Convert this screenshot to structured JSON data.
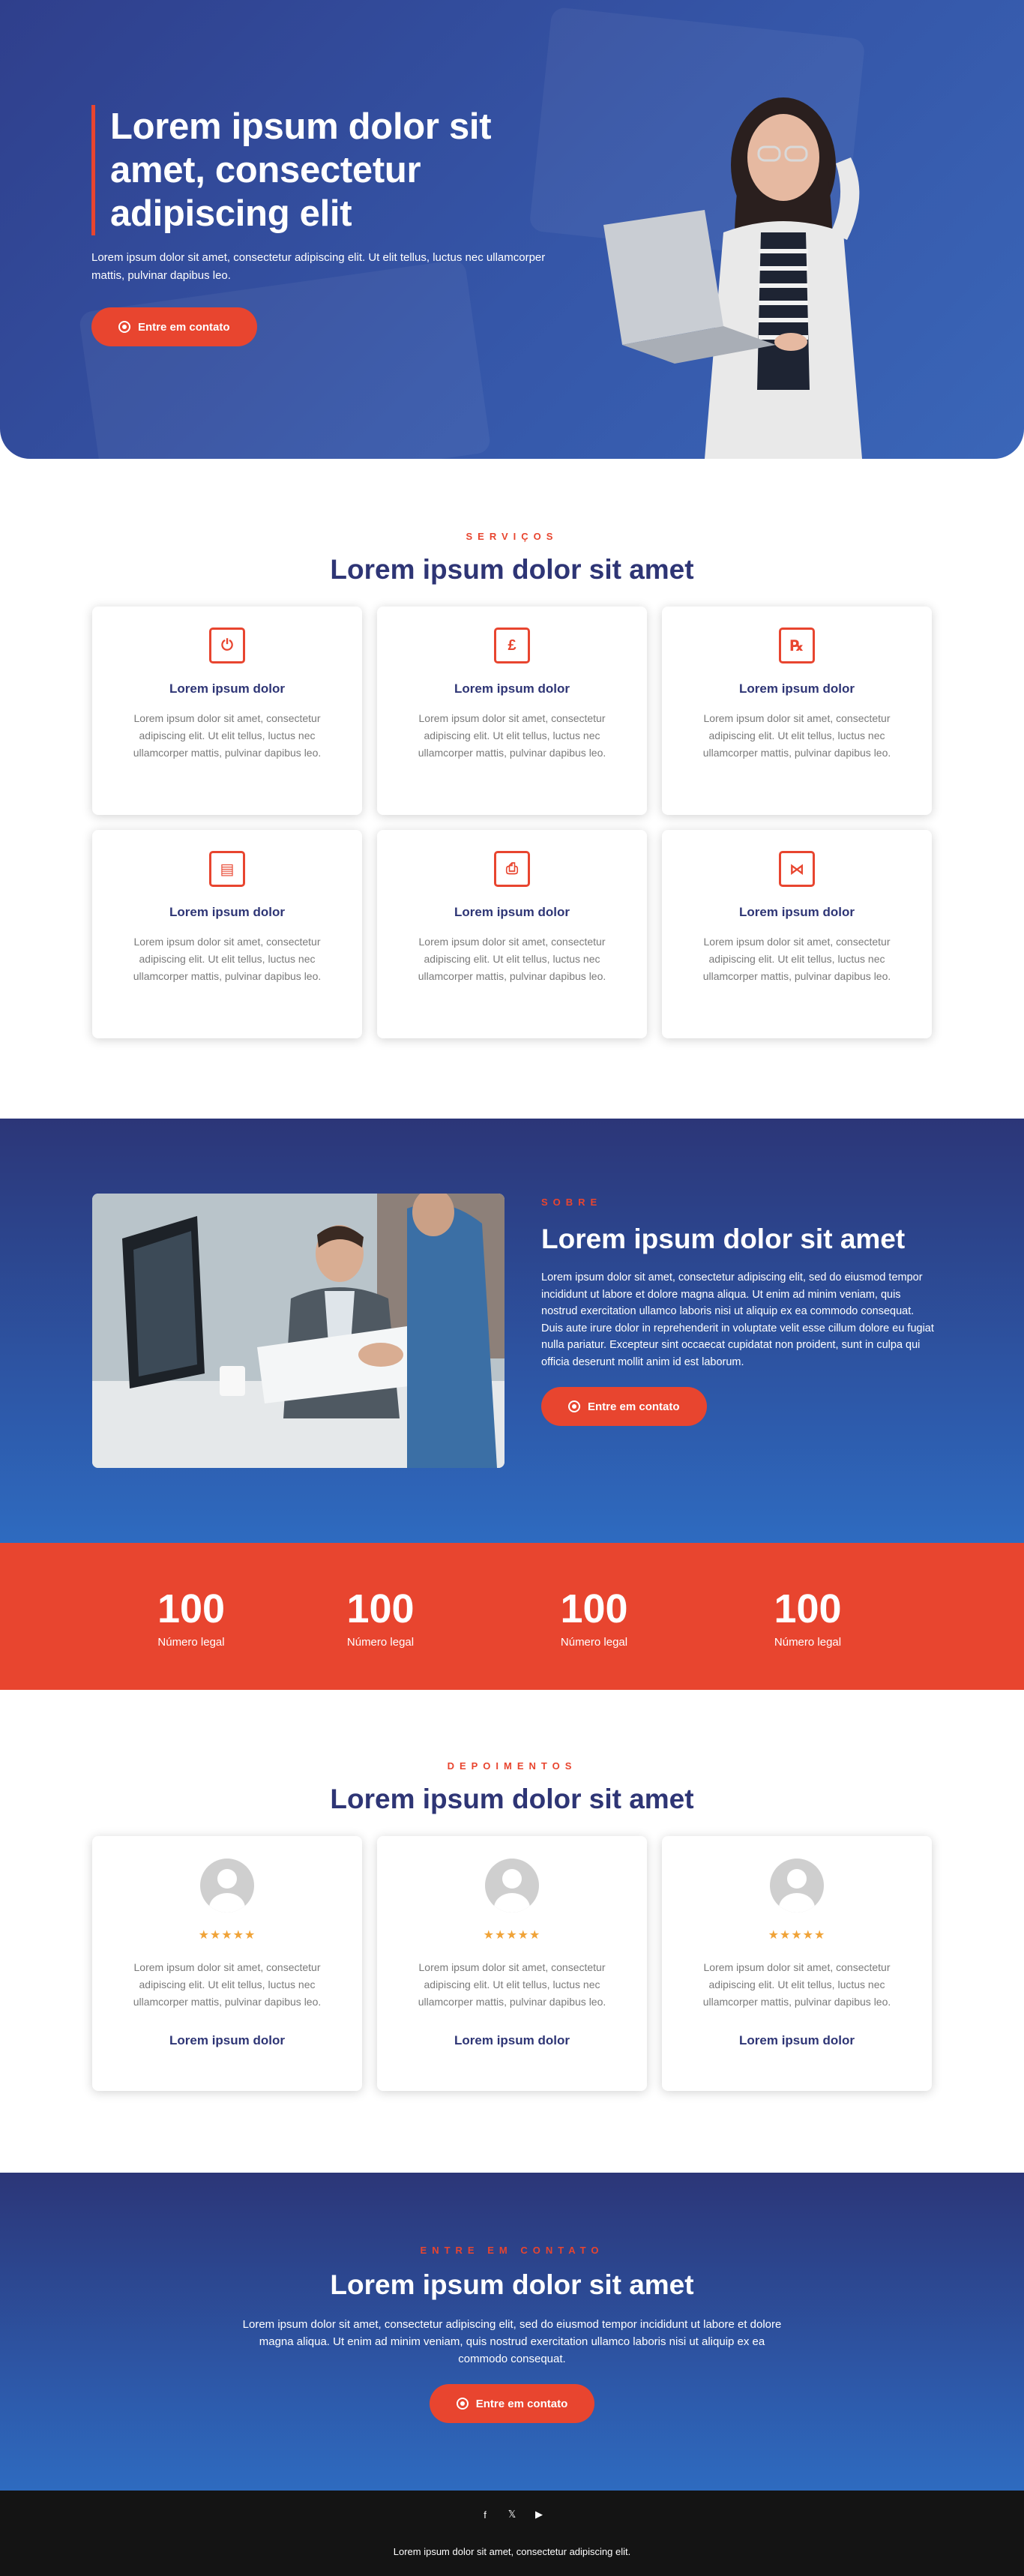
{
  "colors": {
    "accent": "#e8452f",
    "navy": "#2e3575",
    "blue": "#2d5aab",
    "footer": "#141414",
    "star": "#f0a338"
  },
  "hero": {
    "title": "Lorem ipsum dolor sit amet, consectetur adipiscing elit",
    "text": "Lorem ipsum dolor sit amet, consectetur adipiscing elit. Ut elit tellus, luctus nec ullamcorper mattis, pulvinar dapibus leo.",
    "button_label": "Entre em contato"
  },
  "services": {
    "eyebrow": "SERVIÇOS",
    "title": "Lorem ipsum dolor sit amet",
    "items": [
      {
        "icon": "power-icon",
        "glyph": "⏻",
        "title": "Lorem ipsum dolor",
        "text": "Lorem ipsum dolor sit amet, consectetur adipiscing elit. Ut elit tellus, luctus nec ullamcorper mattis, pulvinar dapibus leo."
      },
      {
        "icon": "pound-icon",
        "glyph": "£",
        "title": "Lorem ipsum dolor",
        "text": "Lorem ipsum dolor sit amet, consectetur adipiscing elit. Ut elit tellus, luctus nec ullamcorper mattis, pulvinar dapibus leo."
      },
      {
        "icon": "prescription-icon",
        "glyph": "℞",
        "title": "Lorem ipsum dolor",
        "text": "Lorem ipsum dolor sit amet, consectetur adipiscing elit. Ut elit tellus, luctus nec ullamcorper mattis, pulvinar dapibus leo."
      },
      {
        "icon": "trash-icon",
        "glyph": "▤",
        "title": "Lorem ipsum dolor",
        "text": "Lorem ipsum dolor sit amet, consectetur adipiscing elit. Ut elit tellus, luctus nec ullamcorper mattis, pulvinar dapibus leo."
      },
      {
        "icon": "print-icon",
        "glyph": "⎙",
        "title": "Lorem ipsum dolor",
        "text": "Lorem ipsum dolor sit amet, consectetur adipiscing elit. Ut elit tellus, luctus nec ullamcorper mattis, pulvinar dapibus leo."
      },
      {
        "icon": "network-icon",
        "glyph": "⋈",
        "title": "Lorem ipsum dolor",
        "text": "Lorem ipsum dolor sit amet, consectetur adipiscing elit. Ut elit tellus, luctus nec ullamcorper mattis, pulvinar dapibus leo."
      }
    ]
  },
  "about": {
    "eyebrow": "SOBRE",
    "title": "Lorem ipsum dolor sit amet",
    "text": "Lorem ipsum dolor sit amet, consectetur adipiscing elit, sed do eiusmod tempor incididunt ut labore et dolore magna aliqua. Ut enim ad minim veniam, quis nostrud exercitation ullamco laboris nisi ut aliquip ex ea commodo consequat. Duis aute irure dolor in reprehenderit in voluptate velit esse cillum dolore eu fugiat nulla pariatur. Excepteur sint occaecat cupidatat non proident, sunt in culpa qui officia deserunt mollit anim id est laborum.",
    "button_label": "Entre em contato"
  },
  "stats": [
    {
      "value": "100",
      "label": "Número legal"
    },
    {
      "value": "100",
      "label": "Número legal"
    },
    {
      "value": "100",
      "label": "Número legal"
    },
    {
      "value": "100",
      "label": "Número legal"
    }
  ],
  "testimonials": {
    "eyebrow": "DEPOIMENTOS",
    "title": "Lorem ipsum dolor sit amet",
    "items": [
      {
        "stars": "★★★★★",
        "rating": 5,
        "text": "Lorem ipsum dolor sit amet, consectetur adipiscing elit. Ut elit tellus, luctus nec ullamcorper mattis, pulvinar dapibus leo.",
        "name": "Lorem ipsum dolor"
      },
      {
        "stars": "★★★★★",
        "rating": 5,
        "text": "Lorem ipsum dolor sit amet, consectetur adipiscing elit. Ut elit tellus, luctus nec ullamcorper mattis, pulvinar dapibus leo.",
        "name": "Lorem ipsum dolor"
      },
      {
        "stars": "★★★★★",
        "rating": 5,
        "text": "Lorem ipsum dolor sit amet, consectetur adipiscing elit. Ut elit tellus, luctus nec ullamcorper mattis, pulvinar dapibus leo.",
        "name": "Lorem ipsum dolor"
      }
    ]
  },
  "contact": {
    "eyebrow": "ENTRE EM CONTATO",
    "title": "Lorem ipsum dolor sit amet",
    "text": "Lorem ipsum dolor sit amet, consectetur adipiscing elit, sed do eiusmod tempor incididunt ut labore et dolore magna aliqua. Ut enim ad minim veniam, quis nostrud exercitation ullamco laboris nisi ut aliquip ex ea commodo consequat.",
    "button_label": "Entre em contato"
  },
  "footer": {
    "social": [
      {
        "icon": "facebook-icon",
        "glyph": "f"
      },
      {
        "icon": "twitter-icon",
        "glyph": "𝕏"
      },
      {
        "icon": "youtube-icon",
        "glyph": "▶"
      }
    ],
    "text": "Lorem ipsum dolor sit amet, consectetur adipiscing elit."
  }
}
